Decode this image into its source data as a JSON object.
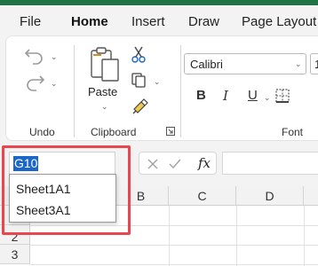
{
  "tabs": [
    {
      "label": "File"
    },
    {
      "label": "Home"
    },
    {
      "label": "Insert"
    },
    {
      "label": "Draw"
    },
    {
      "label": "Page Layout"
    }
  ],
  "active_tab": "Home",
  "ribbon": {
    "undo_group_label": "Undo",
    "paste_label": "Paste",
    "clipboard_group_label": "Clipboard",
    "font_group_label": "Font",
    "font_name": "Calibri",
    "font_size": "1",
    "bold": "B",
    "italic": "I",
    "underline": "U"
  },
  "formula_bar": {
    "name_box_value": "G10",
    "fx_label": "fx",
    "formula_value": ""
  },
  "name_dropdown": {
    "items": [
      "Sheet1A1",
      "Sheet3A1"
    ]
  },
  "grid": {
    "columns": [
      "B",
      "C",
      "D"
    ],
    "rows": [
      "2",
      "3"
    ]
  },
  "colors": {
    "accent": "#217346",
    "selection": "#1a66c9",
    "highlight": "#e8474f"
  }
}
